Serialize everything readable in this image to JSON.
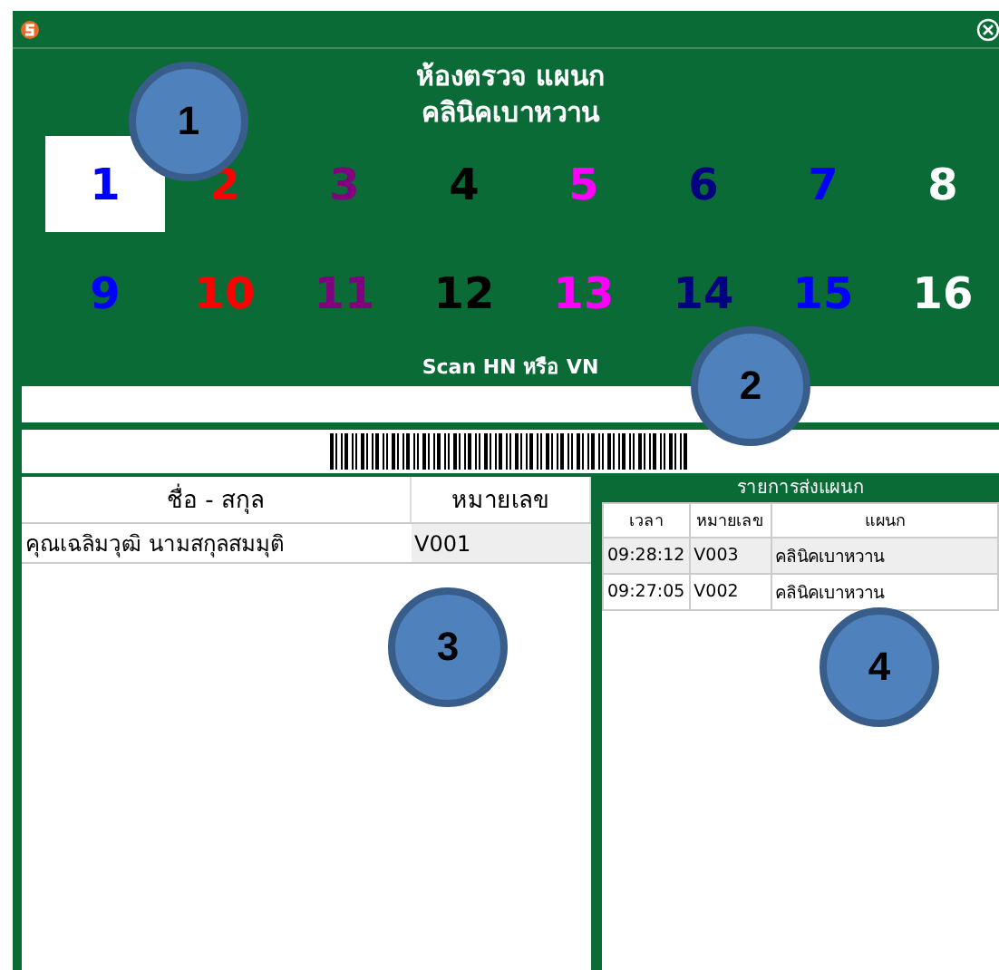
{
  "title_lines": [
    "ห้องตรวจ แผนก",
    "คลินิคเบาหวาน"
  ],
  "rooms": [
    {
      "label": "1",
      "color": "#0000ff",
      "selected": true
    },
    {
      "label": "2",
      "color": "#ff0000",
      "selected": false
    },
    {
      "label": "3",
      "color": "#800080",
      "selected": false
    },
    {
      "label": "4",
      "color": "#000000",
      "selected": false
    },
    {
      "label": "5",
      "color": "#ff00ff",
      "selected": false
    },
    {
      "label": "6",
      "color": "#000080",
      "selected": false
    },
    {
      "label": "7",
      "color": "#0000ff",
      "selected": false
    },
    {
      "label": "8",
      "color": "#ffffff",
      "selected": false
    },
    {
      "label": "9",
      "color": "#0000ff",
      "selected": false
    },
    {
      "label": "10",
      "color": "#ff0000",
      "selected": false
    },
    {
      "label": "11",
      "color": "#800080",
      "selected": false
    },
    {
      "label": "12",
      "color": "#000000",
      "selected": false
    },
    {
      "label": "13",
      "color": "#ff00ff",
      "selected": false
    },
    {
      "label": "14",
      "color": "#000080",
      "selected": false
    },
    {
      "label": "15",
      "color": "#0000ff",
      "selected": false
    },
    {
      "label": "16",
      "color": "#ffffff",
      "selected": false
    }
  ],
  "scan": {
    "label": "Scan HN หรือ VN"
  },
  "patient_table": {
    "columns": [
      "ชื่อ - สกุล",
      "หมายเลข"
    ],
    "rows": [
      [
        "คุณเฉลิมวุฒิ  นามสกุลสมมุติ",
        "V001"
      ]
    ]
  },
  "sent_list": {
    "title": "รายการส่งแผนก",
    "columns": [
      "เวลา",
      "หมายเลข",
      "แผนก"
    ],
    "rows": [
      [
        "09:28:12",
        "V003",
        "คลินิคเบาหวาน"
      ],
      [
        "09:27:05",
        "V002",
        "คลินิคเบาหวาน"
      ]
    ]
  },
  "callouts": [
    "1",
    "2",
    "3",
    "4"
  ]
}
